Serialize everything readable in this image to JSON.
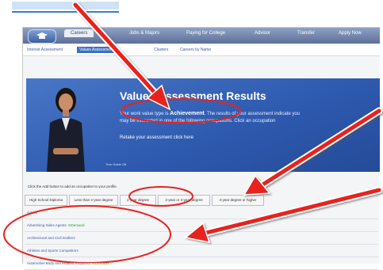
{
  "nav": {
    "tabs": [
      {
        "label": "Careers"
      },
      {
        "label": "Jobs & Majors"
      },
      {
        "label": "Paying for College"
      },
      {
        "label": "Advisor"
      },
      {
        "label": "Transfer"
      },
      {
        "label": "Apply Now"
      }
    ]
  },
  "subnav": {
    "items": [
      {
        "label": "Interest Assessment"
      },
      {
        "label": "Values Assessment"
      },
      {
        "label": "Clusters"
      },
      {
        "label": "Careers by Name"
      }
    ]
  },
  "banner": {
    "title": "Values Assessment Results",
    "line1_prefix": "Your work value type is ",
    "value_type": "Achievement",
    "line1_suffix": ". The results of your assessment indicate you",
    "line2": "may be interested in one of the following occupations. Click an occupation",
    "retake": "Retake your assessment click here",
    "caption": "Turn Guide Off"
  },
  "hint": "Click the Add button to add an occupation to your profile.",
  "degree_tabs": [
    {
      "label": "High School Diploma"
    },
    {
      "label": "Less than 2-year degree"
    },
    {
      "label": "2-year degree"
    },
    {
      "label": "2-year or 4-year degree"
    },
    {
      "label": "4-year degree or higher"
    }
  ],
  "occupations": [
    {
      "name": "Actors",
      "flag": ""
    },
    {
      "name": "Advertising Sales Agents",
      "flag": "InDemand"
    },
    {
      "name": "Architectural and Civil Drafters",
      "flag": ""
    },
    {
      "name": "Athletes and Sports Competitors",
      "flag": ""
    },
    {
      "name": "Automotive Body and Related Repairers",
      "flag": "InDemand"
    }
  ],
  "colors": {
    "accent": "#2e5ab0",
    "annotation_red": "#e8231f",
    "indemand_green": "#2e9a2e"
  }
}
